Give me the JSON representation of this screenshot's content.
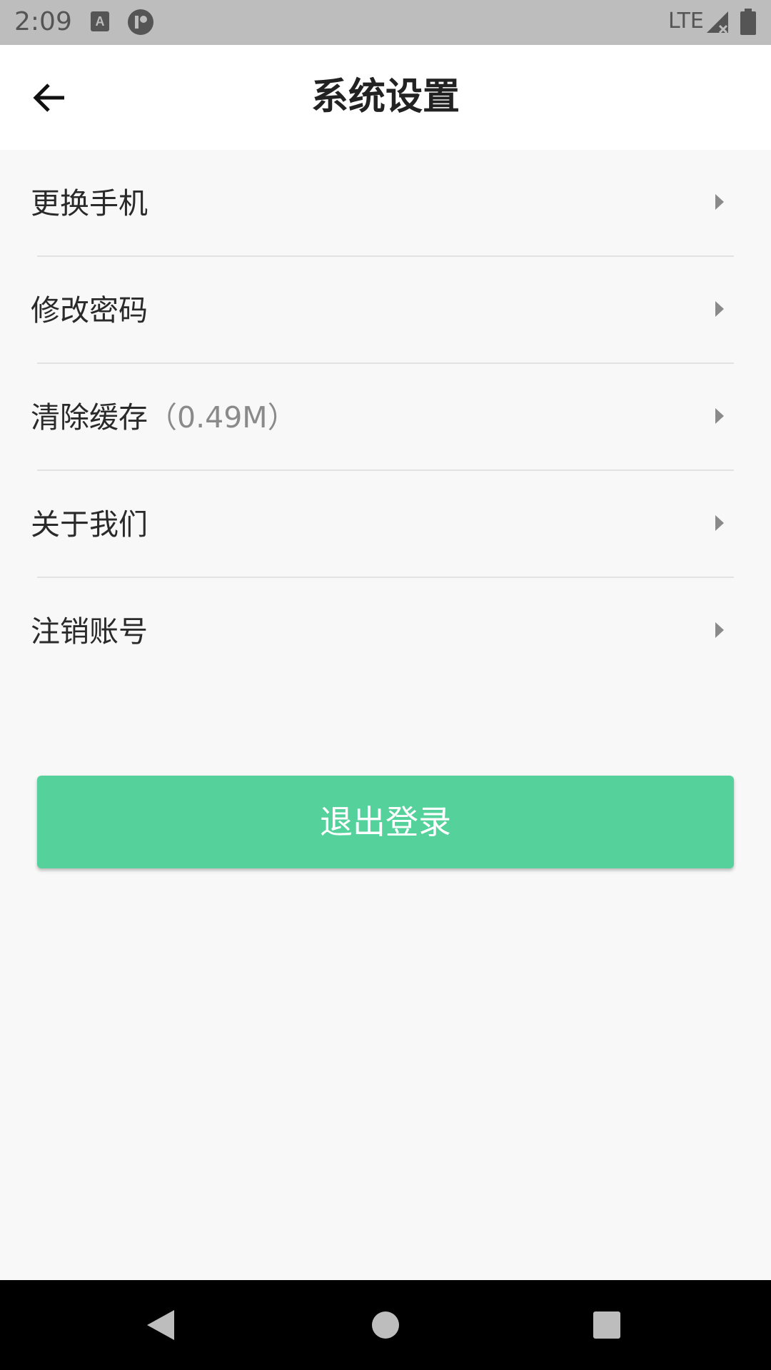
{
  "status_bar": {
    "time": "2:09",
    "network": "LTE",
    "icons": [
      "a-notification-icon",
      "p-notification-icon",
      "signal-icon",
      "battery-icon"
    ]
  },
  "header": {
    "title": "系统设置",
    "back_icon": "arrow-left-icon"
  },
  "menu": {
    "items": [
      {
        "label": "更换手机",
        "extra": ""
      },
      {
        "label": "修改密码",
        "extra": ""
      },
      {
        "label": "清除缓存",
        "extra": "（0.49M）"
      },
      {
        "label": "关于我们",
        "extra": ""
      },
      {
        "label": "注销账号",
        "extra": ""
      }
    ],
    "chevron_icon": "chevron-right-icon"
  },
  "logout": {
    "label": "退出登录"
  },
  "colors": {
    "accent": "#55d19c",
    "background": "#f8f8f8",
    "status_bar": "#bdbdbd",
    "nav_bar": "#000000"
  },
  "nav_bar": {
    "icons": [
      "nav-back-icon",
      "nav-home-icon",
      "nav-recents-icon"
    ]
  }
}
